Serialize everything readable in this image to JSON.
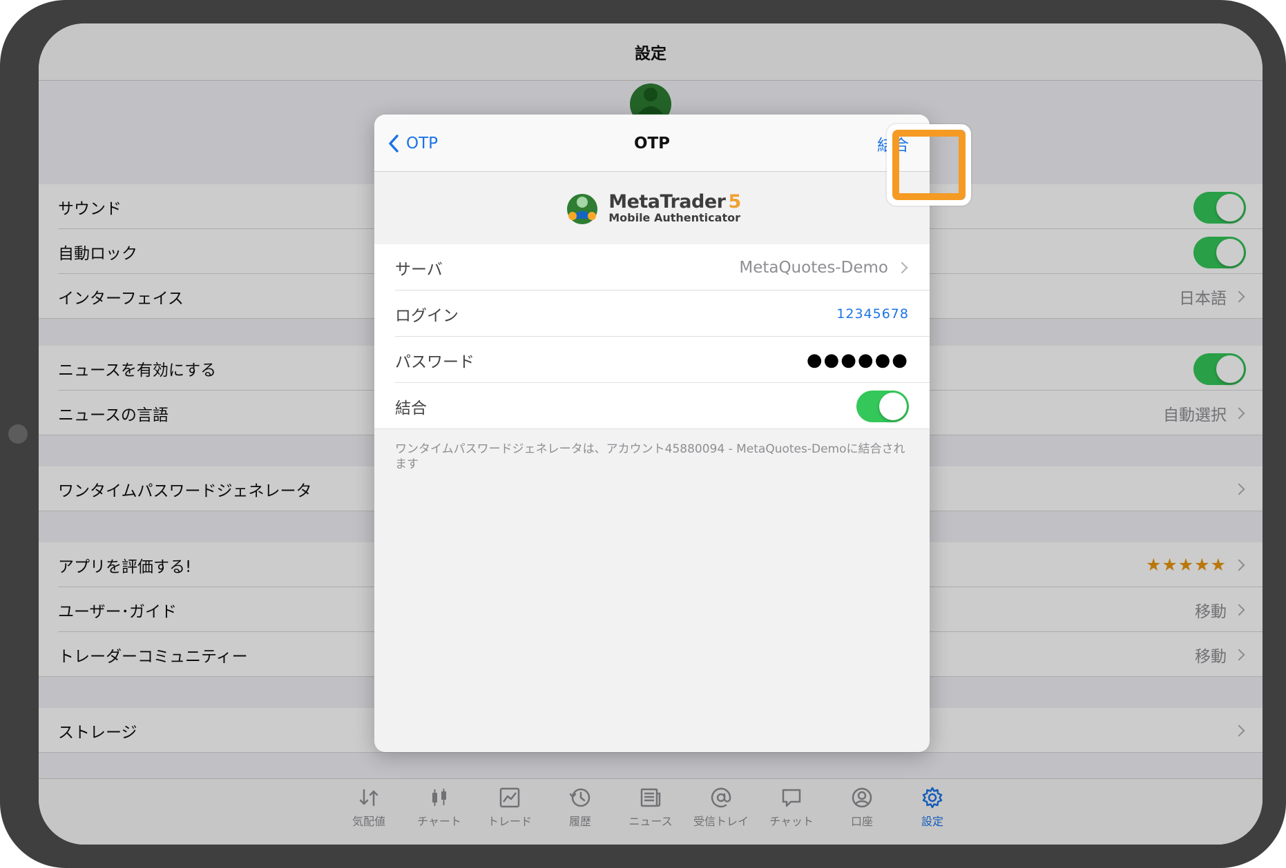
{
  "settings": {
    "title": "設定",
    "rows": [
      {
        "label": "サウンド",
        "toggle": true
      },
      {
        "label": "自動ロック",
        "toggle": true
      },
      {
        "label": "インターフェイス",
        "value": "日本語"
      },
      {
        "label": "ニュースを有効にする",
        "toggle": true
      },
      {
        "label": "ニュースの言語",
        "value": "自動選択"
      },
      {
        "label": "ワンタイムパスワードジェネレータ",
        "value": ""
      },
      {
        "label": "アプリを評価する!",
        "stars": "★★★★★"
      },
      {
        "label": "ユーザー･ガイド",
        "value": "移動"
      },
      {
        "label": "トレーダーコミュニティー",
        "value": "移動"
      },
      {
        "label": "ストレージ",
        "value": ""
      }
    ]
  },
  "tabbar": {
    "active": "設定",
    "tabs": [
      {
        "label": "気配値",
        "icon": "quotes-icon"
      },
      {
        "label": "チャート",
        "icon": "chart-icon"
      },
      {
        "label": "トレード",
        "icon": "trade-icon"
      },
      {
        "label": "履歴",
        "icon": "history-icon"
      },
      {
        "label": "ニュース",
        "icon": "news-icon"
      },
      {
        "label": "受信トレイ",
        "icon": "mailbox-icon"
      },
      {
        "label": "チャット",
        "icon": "chat-icon"
      },
      {
        "label": "口座",
        "icon": "account-icon"
      },
      {
        "label": "設定",
        "icon": "gear-icon"
      }
    ]
  },
  "modal": {
    "back_label": "OTP",
    "title": "OTP",
    "action_label": "結合",
    "brand": {
      "name": "MetaTrader",
      "version": "5",
      "subtitle": "Mobile Authenticator"
    },
    "rows": {
      "server": {
        "label": "サーバ",
        "value": "MetaQuotes-Demo"
      },
      "login": {
        "label": "ログイン",
        "value": "12345678"
      },
      "password": {
        "label": "パスワード",
        "value": "●●●●●●"
      },
      "bind": {
        "label": "結合",
        "toggle": true
      }
    },
    "footnote": "ワンタイムパスワードジェネレータは、アカウント45880094 - MetaQuotes-Demoに結合されます"
  },
  "colors": {
    "accent": "#1a73e8",
    "toggle_on": "#34c759",
    "highlight": "#f59a23",
    "stars": "#e8950f"
  }
}
